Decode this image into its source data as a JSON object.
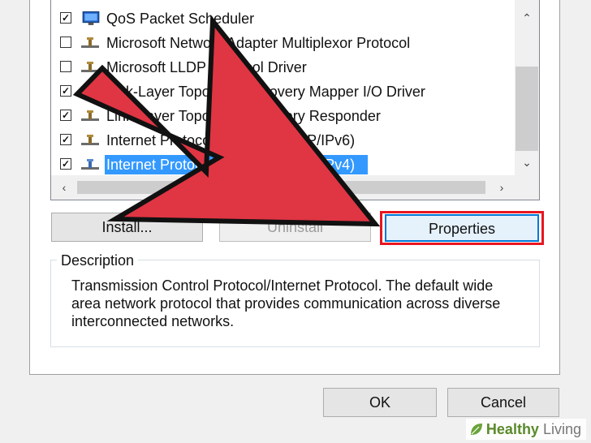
{
  "components": {
    "items": [
      {
        "label": "QoS Packet Scheduler",
        "checked": true,
        "selected": false,
        "icon": "scheduler-icon"
      },
      {
        "label": "Microsoft Network Adapter Multiplexor Protocol",
        "checked": false,
        "selected": false,
        "icon": "protocol-icon"
      },
      {
        "label": "Microsoft LLDP Protocol Driver",
        "checked": false,
        "selected": false,
        "icon": "protocol-icon"
      },
      {
        "label": "Link-Layer Topology Discovery Mapper I/O Driver",
        "checked": true,
        "selected": false,
        "icon": "protocol-icon"
      },
      {
        "label": "Link-Layer Topology Discovery Responder",
        "checked": true,
        "selected": false,
        "icon": "protocol-icon"
      },
      {
        "label": "Internet Protocol Version 6 (TCP/IPv6)",
        "checked": true,
        "selected": false,
        "icon": "protocol-icon"
      },
      {
        "label": "Internet Protocol Version 4 (TCP/IPv4)",
        "checked": true,
        "selected": true,
        "icon": "protocol-icon"
      }
    ]
  },
  "buttons": {
    "install": "Install...",
    "uninstall": "Uninstall",
    "properties": "Properties",
    "ok": "OK",
    "cancel": "Cancel"
  },
  "description": {
    "title": "Description",
    "text": "Transmission Control Protocol/Internet Protocol. The default wide area network protocol that provides communication across diverse interconnected networks."
  },
  "annotation": {
    "arrow_color": "#e03543",
    "highlight_color": "#e8161f"
  },
  "watermark": {
    "brand_bold": "Healthy",
    "brand_light": "Living"
  },
  "colors": {
    "selection": "#3399ff",
    "focus_border": "#0078d7"
  }
}
